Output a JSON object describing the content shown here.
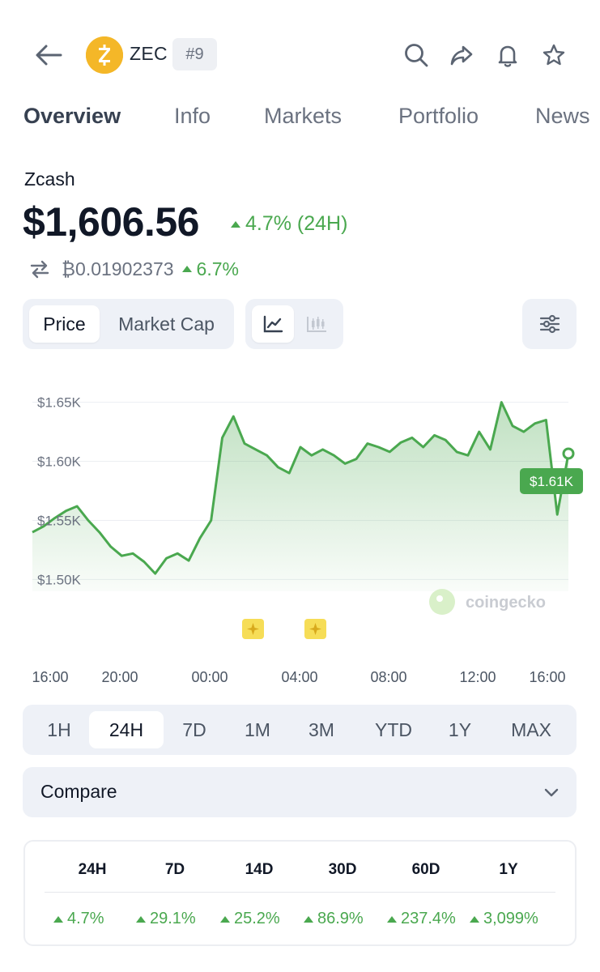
{
  "header": {
    "coin_symbol": "ZEC",
    "rank": "#9",
    "logo_letter": "Z"
  },
  "tabs": [
    "Overview",
    "Info",
    "Markets",
    "Portfolio",
    "News"
  ],
  "coin": {
    "name": "Zcash",
    "price": "$1,606.56",
    "change_24h": "4.7% (24H)",
    "btc_price": "₿0.01902373",
    "btc_change": "6.7%"
  },
  "chart_toggle": {
    "price_label": "Price",
    "market_cap_label": "Market Cap"
  },
  "chart_data": {
    "type": "area",
    "y_tick_labels": [
      "$1.65K",
      "$1.60K",
      "$1.55K",
      "$1.50K"
    ],
    "y_ticks": [
      1650,
      1600,
      1550,
      1500
    ],
    "ylim": [
      1490,
      1660
    ],
    "x_tick_labels": [
      "16:00",
      "20:00",
      "00:00",
      "04:00",
      "08:00",
      "12:00",
      "16:00"
    ],
    "x": [
      0,
      0.5,
      1,
      1.5,
      2,
      2.5,
      3,
      3.5,
      4,
      4.5,
      5,
      5.5,
      6,
      6.5,
      7,
      7.5,
      8,
      8.5,
      9,
      9.5,
      10,
      10.5,
      11,
      11.5,
      12,
      12.5,
      13,
      13.5,
      14,
      14.5,
      15,
      15.5,
      16,
      16.5,
      17,
      17.5,
      18,
      18.5,
      19,
      19.5,
      20,
      20.5,
      21,
      21.5,
      22,
      22.5,
      23,
      23.5,
      24
    ],
    "values": [
      1540,
      1545,
      1552,
      1558,
      1562,
      1550,
      1540,
      1528,
      1520,
      1522,
      1515,
      1505,
      1518,
      1522,
      1516,
      1535,
      1550,
      1620,
      1638,
      1615,
      1610,
      1605,
      1595,
      1590,
      1612,
      1605,
      1610,
      1605,
      1598,
      1602,
      1615,
      1612,
      1608,
      1616,
      1620,
      1612,
      1622,
      1618,
      1608,
      1605,
      1625,
      1610,
      1650,
      1630,
      1625,
      1632,
      1635,
      1555,
      1606.56
    ],
    "current_label": "$1.61K",
    "watermark": "coingecko",
    "color": "#4aa84f"
  },
  "ranges": [
    "1H",
    "24H",
    "7D",
    "1M",
    "3M",
    "YTD",
    "1Y",
    "MAX"
  ],
  "active_range": "24H",
  "compare": {
    "label": "Compare"
  },
  "performance": [
    {
      "period": "24H",
      "value": "4.7%"
    },
    {
      "period": "7D",
      "value": "29.1%"
    },
    {
      "period": "14D",
      "value": "25.2%"
    },
    {
      "period": "30D",
      "value": "86.9%"
    },
    {
      "period": "60D",
      "value": "237.4%"
    },
    {
      "period": "1Y",
      "value": "3,099%"
    }
  ],
  "colors": {
    "positive": "#4aa84f",
    "brand_zec": "#f4b728",
    "segment_bg": "#eef1f7"
  }
}
